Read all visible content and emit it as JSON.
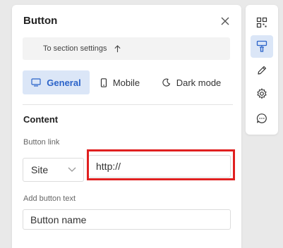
{
  "panel": {
    "title": "Button",
    "section_link": "To section settings",
    "tabs": [
      {
        "label": "General",
        "active": true
      },
      {
        "label": "Mobile",
        "active": false
      },
      {
        "label": "Dark mode",
        "active": false
      }
    ],
    "content_title": "Content",
    "button_link_label": "Button link",
    "link_type_value": "Site",
    "link_value": "http://",
    "button_text_label": "Add button text",
    "button_text_value": "Button name"
  },
  "toolbar": {
    "items": [
      {
        "icon": "qr-code-icon",
        "active": false
      },
      {
        "icon": "paint-roller-icon",
        "active": true
      },
      {
        "icon": "pencil-icon",
        "active": false
      },
      {
        "icon": "gear-icon",
        "active": false
      },
      {
        "icon": "chat-icon",
        "active": false
      }
    ]
  },
  "colors": {
    "accent": "#2b63c9",
    "active_bg": "#dbe6f7",
    "highlight": "#e02020"
  }
}
